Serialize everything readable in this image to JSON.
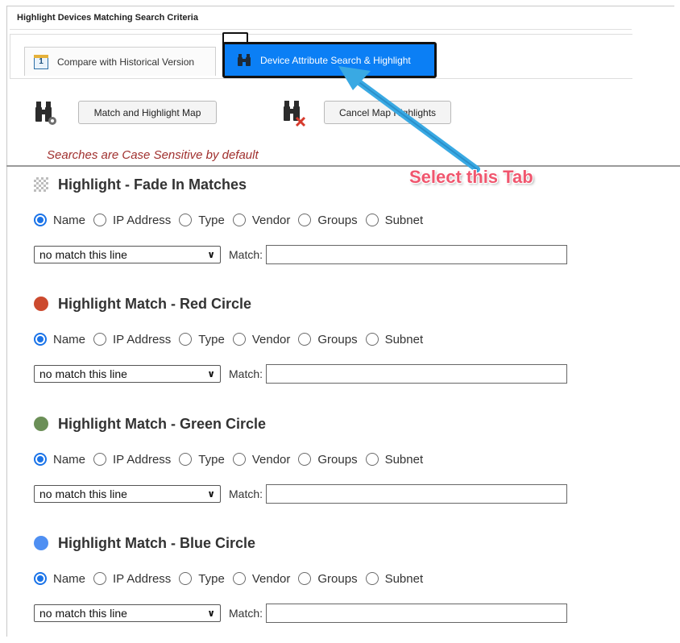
{
  "panel": {
    "title": "Highlight Devices Matching Search Criteria"
  },
  "tabs": [
    {
      "label": "Compare with Historical Version",
      "active": false
    },
    {
      "label": "Device Attribute Search & Highlight",
      "active": true
    }
  ],
  "toolbar": {
    "match_button": "Match and Highlight Map",
    "cancel_button": "Cancel Map Highlights",
    "note": "Searches are Case Sensitive by default"
  },
  "annotation": {
    "text": "Select this Tab",
    "color": "#f0566e"
  },
  "radio_options": [
    "Name",
    "IP Address",
    "Type",
    "Vendor",
    "Groups",
    "Subnet"
  ],
  "sections": [
    {
      "title": "Highlight - Fade In Matches",
      "marker": "checker",
      "color": "#bdbdbd",
      "selected": "Name",
      "dropdown": "no match this line",
      "match_label": "Match:",
      "match_value": ""
    },
    {
      "title": "Highlight Match - Red Circle",
      "marker": "circle",
      "color": "#cc4a2e",
      "selected": "Name",
      "dropdown": "no match this line",
      "match_label": "Match:",
      "match_value": ""
    },
    {
      "title": "Highlight Match - Green Circle",
      "marker": "circle",
      "color": "#6b8f57",
      "selected": "Name",
      "dropdown": "no match this line",
      "match_label": "Match:",
      "match_value": ""
    },
    {
      "title": "Highlight Match - Blue Circle",
      "marker": "circle",
      "color": "#4f8ff2",
      "selected": "Name",
      "dropdown": "no match this line",
      "match_label": "Match:",
      "match_value": ""
    }
  ]
}
